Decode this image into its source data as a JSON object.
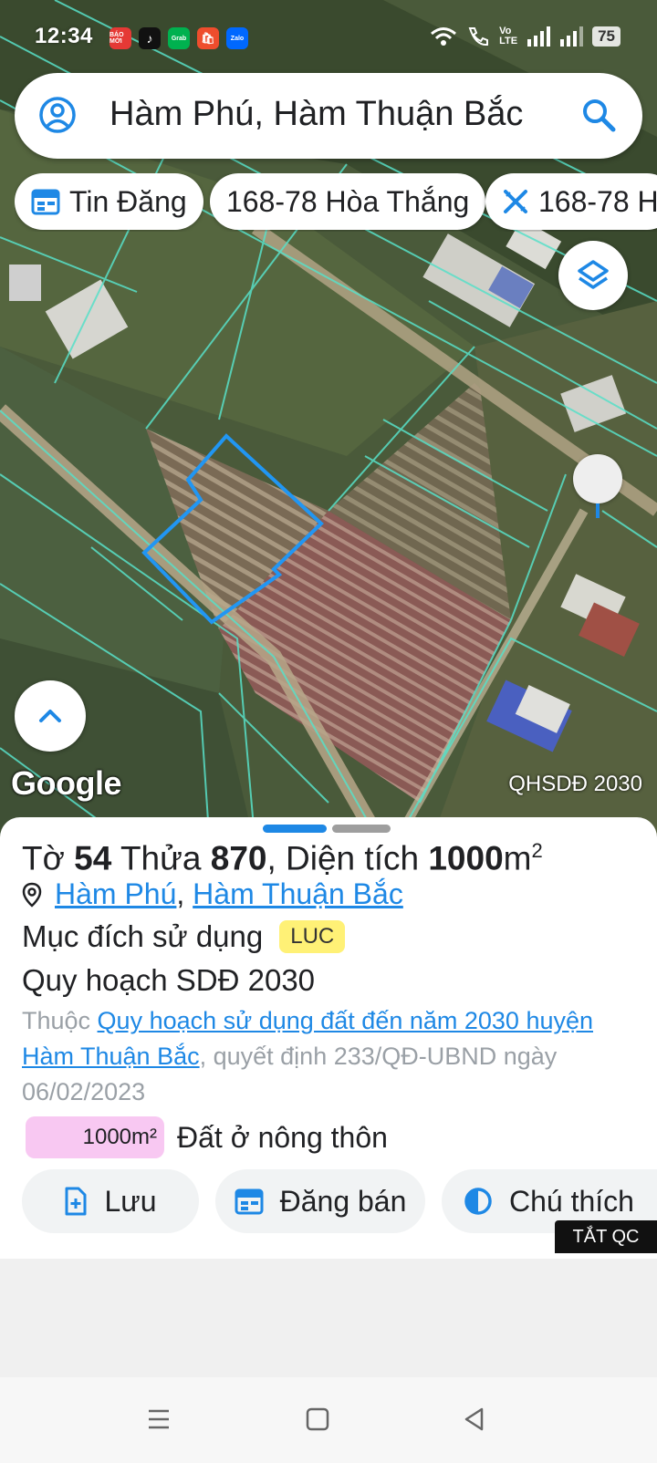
{
  "status_bar": {
    "time": "12:34",
    "battery": "75",
    "apps": [
      {
        "name": "baomoi",
        "label": "BÁO MỚI",
        "color": "#e53935"
      },
      {
        "name": "tiktok",
        "label": "♪",
        "color": "#111111"
      },
      {
        "name": "grab",
        "label": "Grab",
        "color": "#00b14f"
      },
      {
        "name": "shopee",
        "label": "🛍",
        "color": "#ee4d2d"
      },
      {
        "name": "zalo",
        "label": "Zalo",
        "color": "#0068ff"
      }
    ]
  },
  "search": {
    "query": "Hàm Phú, Hàm Thuận Bắc"
  },
  "chips": [
    {
      "label": "Tin Đăng",
      "icon": "calendar-icon"
    },
    {
      "label": "168-78 Hòa Thắng",
      "icon": ""
    },
    {
      "label": "168-78 H",
      "icon": "ruler-cross-icon"
    }
  ],
  "map": {
    "google_logo": "Google",
    "layer_label": "QHSDĐ 2030"
  },
  "sheet": {
    "title_prefix": "Tờ",
    "sheet_no": "54",
    "parcel_prefix": "Thửa",
    "parcel_no": "870",
    "area_prefix": ", Diện tích",
    "area_value": "1000",
    "area_unit": "m",
    "area_sup": "2",
    "location_commune": "Hàm Phú",
    "location_sep": ",",
    "location_district": "Hàm Thuận Bắc",
    "purpose_label": "Mục đích sử dụng",
    "purpose_code": "LUC",
    "plan_title": "Quy hoạch SDĐ 2030",
    "plan_desc_prefix": "Thuộc ",
    "plan_link": "Quy hoạch sử dụng đất đến năm 2030 huyện Hàm Thuận Bắc",
    "plan_desc_suffix": ", quyết định 233/QĐ-UBND ngày 06/02/2023",
    "area_chip": "1000m²",
    "area_chip_label": "Đất ở nông thôn",
    "actions": [
      {
        "label": "Lưu",
        "icon": "save-icon"
      },
      {
        "label": "Đăng bán",
        "icon": "calendar-icon"
      },
      {
        "label": "Chú thích",
        "icon": "legend-icon"
      }
    ],
    "ad_toggle": "TẮT QC"
  },
  "colors": {
    "accent": "#1e88e5",
    "badge": "#fff176",
    "area_chip": "#f8c8f2"
  }
}
